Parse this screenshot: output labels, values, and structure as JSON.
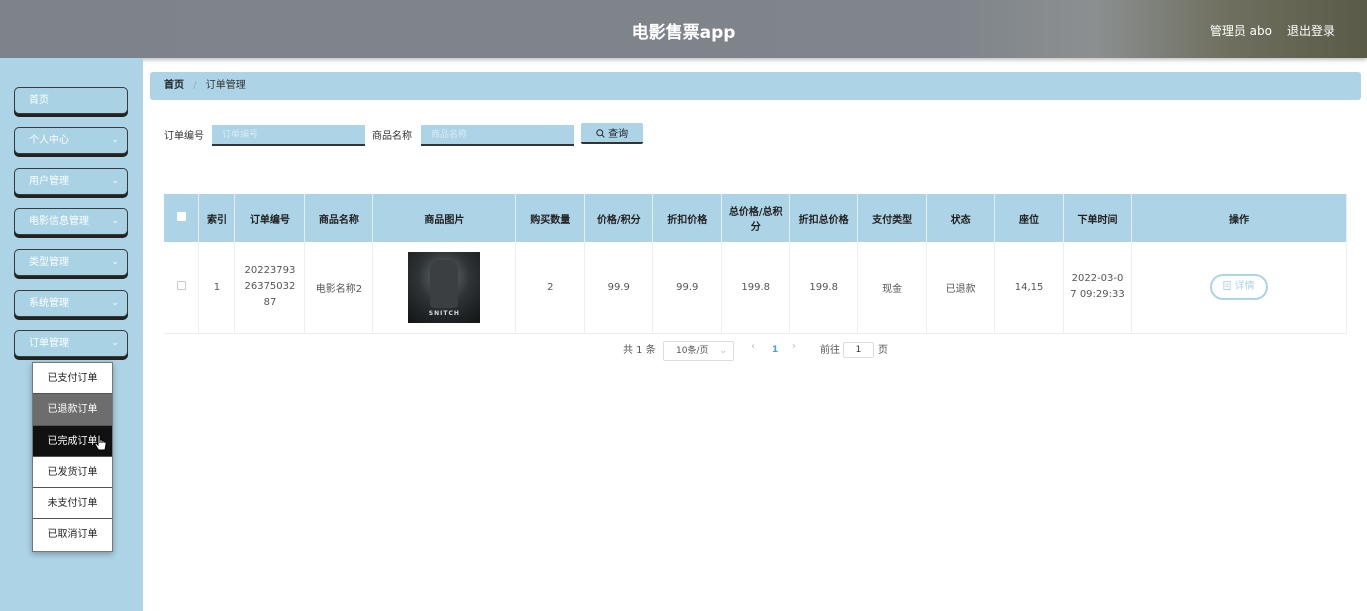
{
  "app": {
    "title": "电影售票app",
    "user": "管理员 abo",
    "logout": "退出登录"
  },
  "sidebar": {
    "items": [
      {
        "label": "首页",
        "has_chevron": false
      },
      {
        "label": "个人中心",
        "has_chevron": true
      },
      {
        "label": "用户管理",
        "has_chevron": true
      },
      {
        "label": "电影信息管理",
        "has_chevron": true
      },
      {
        "label": "类型管理",
        "has_chevron": true
      },
      {
        "label": "系统管理",
        "has_chevron": true
      },
      {
        "label": "订单管理",
        "has_chevron": true
      }
    ],
    "submenu": [
      "已支付订单",
      "已退款订单",
      "已完成订单",
      "已发货订单",
      "未支付订单",
      "已取消订单"
    ],
    "chevron": "⌄"
  },
  "breadcrumb": {
    "home": "首页",
    "sep": "/",
    "current": "订单管理"
  },
  "search": {
    "order_label": "订单编号",
    "order_placeholder": "订单编号",
    "product_label": "商品名称",
    "product_placeholder": "商品名称",
    "button": "查询",
    "button_icon": "search-icon"
  },
  "table": {
    "headers": [
      "索引",
      "订单编号",
      "商品名称",
      "商品图片",
      "购买数量",
      "价格/积分",
      "折扣价格",
      "总价格/总积分",
      "折扣总价格",
      "支付类型",
      "状态",
      "座位",
      "下单时间",
      "操作"
    ],
    "rows": [
      {
        "index": "1",
        "order_no": "202237932637503287",
        "product": "电影名称2",
        "poster_text": "SNITCH",
        "qty": "2",
        "price": "99.9",
        "discount_price": "99.9",
        "total": "199.8",
        "discount_total": "199.8",
        "pay_type": "现金",
        "status": "已退款",
        "seat": "14,15",
        "time": "2022-03-07 09:29:33",
        "action": "详情"
      }
    ]
  },
  "pagination": {
    "total": "共 1 条",
    "page_size": "10条/页",
    "current": "1",
    "goto": "前往",
    "goto_value": "1",
    "page_unit": "页",
    "prev": "‹",
    "next": "›"
  },
  "colors": {
    "accent": "#acd4e6",
    "header": "#7f858b"
  }
}
